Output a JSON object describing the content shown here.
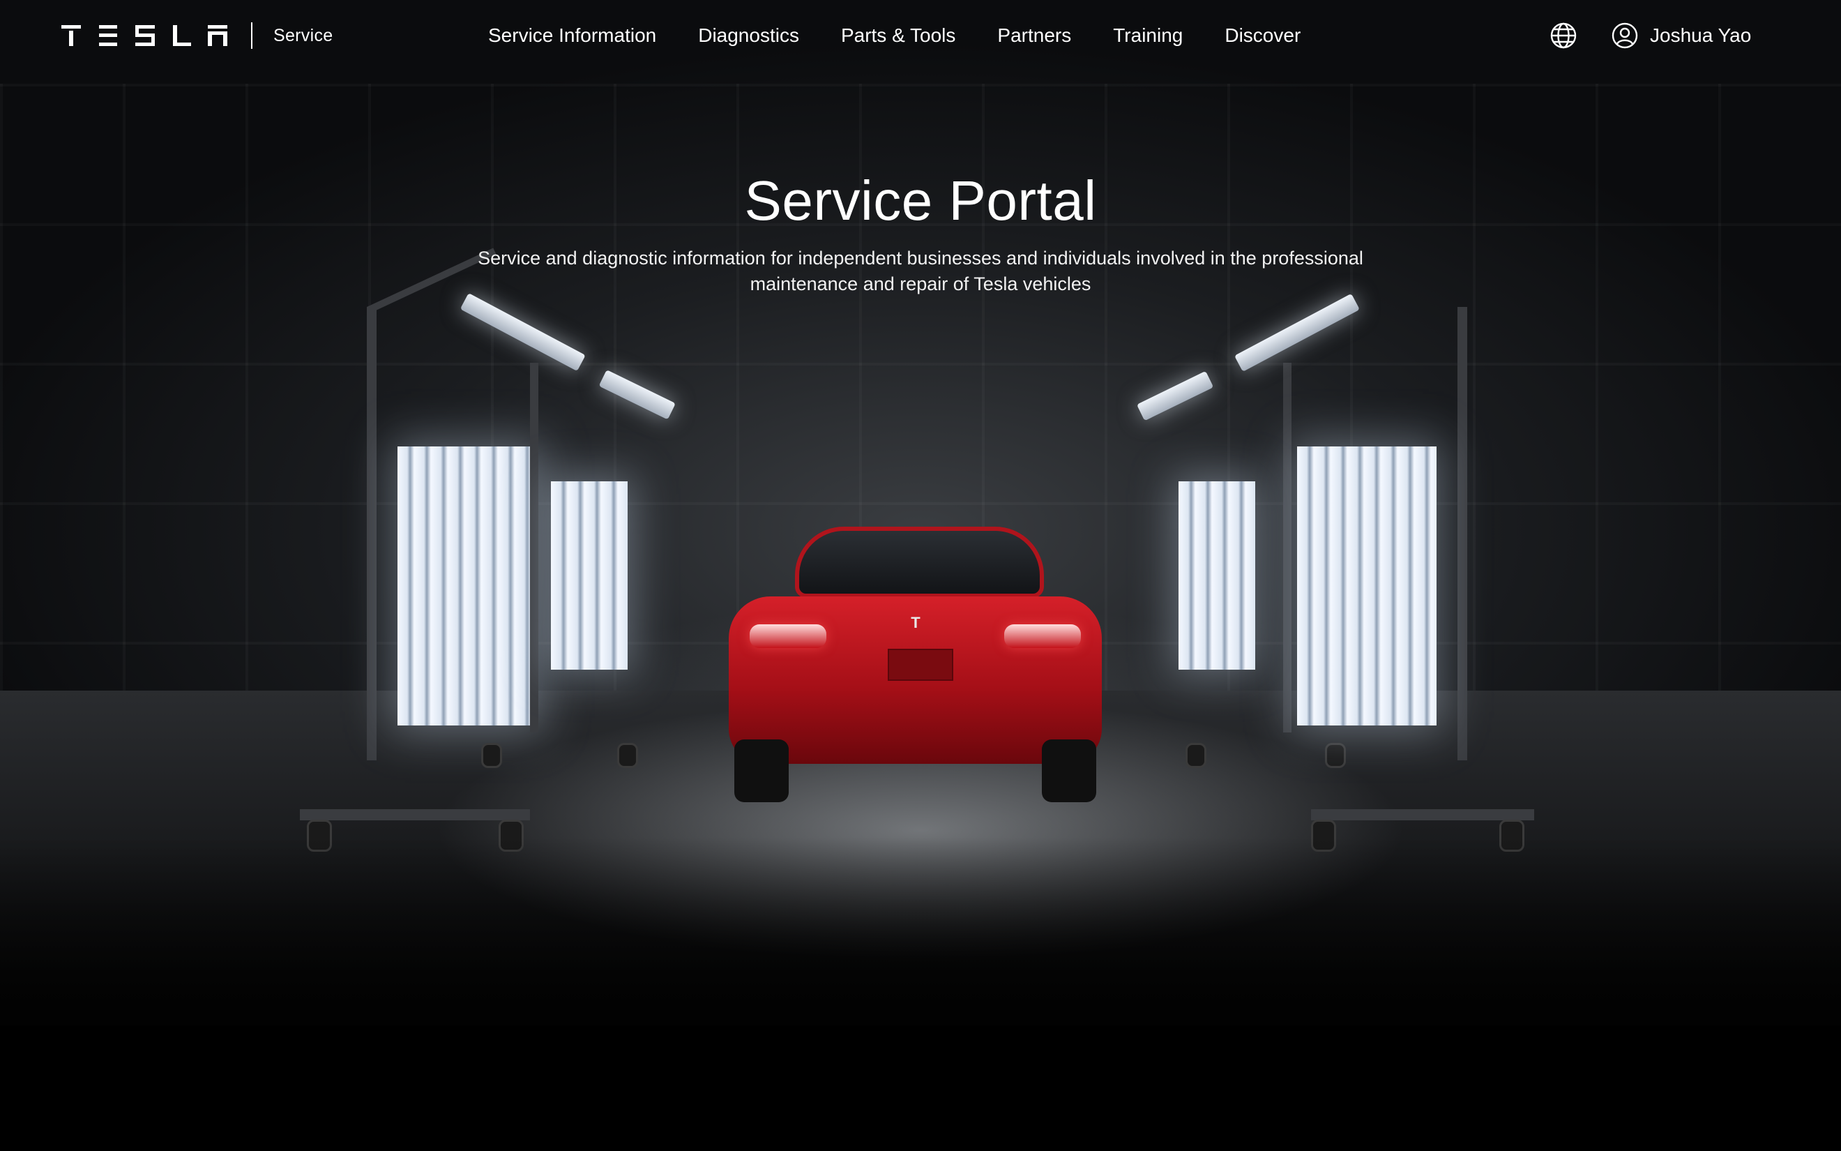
{
  "header": {
    "brand_name": "TESLA",
    "section_label": "Service",
    "nav": [
      {
        "label": "Service Information"
      },
      {
        "label": "Diagnostics"
      },
      {
        "label": "Parts & Tools"
      },
      {
        "label": "Partners"
      },
      {
        "label": "Training"
      },
      {
        "label": "Discover"
      }
    ],
    "language_icon": "globe-icon",
    "account": {
      "icon": "user-circle-icon",
      "name": "Joshua Yao"
    }
  },
  "hero": {
    "title": "Service Portal",
    "subtitle": "Service and diagnostic information for independent businesses and individuals involved in the professional maintenance and repair of Tesla vehicles",
    "image_description_icon": "red-car-in-service-bay-image"
  },
  "colors": {
    "background": "#000000",
    "text": "#ffffff",
    "car_red": "#c8141d"
  }
}
